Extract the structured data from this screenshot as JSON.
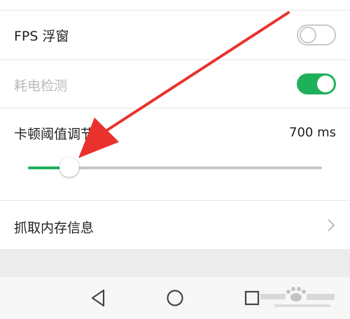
{
  "settings": {
    "fps_window": {
      "label": "FPS 浮窗",
      "enabled": false
    },
    "power_check": {
      "label": "耗电检测",
      "enabled": true,
      "disabled": true
    },
    "lag_threshold": {
      "label": "卡顿阈值调节",
      "value_text": "700 ms",
      "slider_fraction": 0.14
    },
    "memory_capture": {
      "label": "抓取内存信息"
    }
  },
  "nav": {
    "back_icon": "back-triangle-icon",
    "home_icon": "home-circle-icon",
    "recents_icon": "recents-square-icon"
  },
  "annotation": {
    "color": "#e8322b"
  },
  "watermark": {
    "text": "Baidu 经验",
    "url": "jingyan.baidu.com"
  },
  "colors": {
    "accent": "#1fb05a",
    "disabled_text": "#b8b8b8",
    "track": "#c7c7c7"
  }
}
